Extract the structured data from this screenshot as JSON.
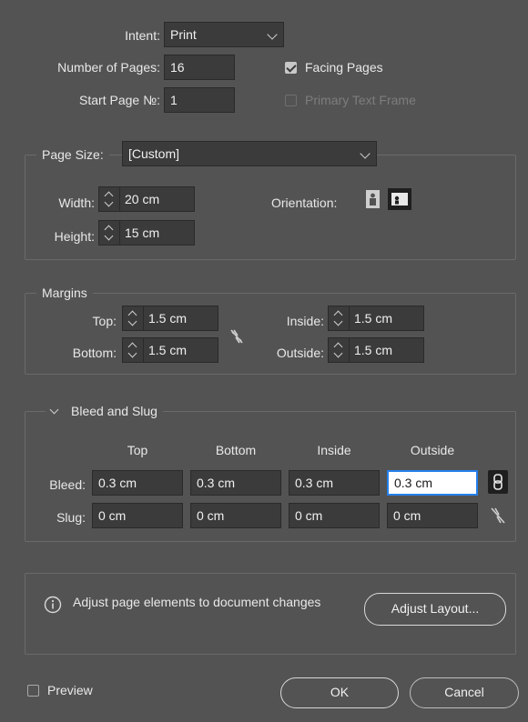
{
  "document": {
    "intent_label": "Intent:",
    "intent_value": "Print",
    "pages_label": "Number of Pages:",
    "pages_value": "16",
    "start_label": "Start Page №:",
    "start_value": "1",
    "facing_pages_label": "Facing Pages",
    "facing_pages_checked": true,
    "primary_text_frame_label": "Primary Text Frame",
    "primary_text_frame_checked": false
  },
  "page_size": {
    "label": "Page Size:",
    "value": "[Custom]",
    "width_label": "Width:",
    "width_value": "20 cm",
    "height_label": "Height:",
    "height_value": "15 cm",
    "orientation_label": "Orientation:",
    "orientation_icons": [
      "portrait-icon",
      "landscape-icon"
    ],
    "orientation_selected": "landscape"
  },
  "margins": {
    "title": "Margins",
    "top_label": "Top:",
    "top_value": "1.5 cm",
    "bottom_label": "Bottom:",
    "bottom_value": "1.5 cm",
    "inside_label": "Inside:",
    "inside_value": "1.5 cm",
    "outside_label": "Outside:",
    "outside_value": "1.5 cm",
    "link_icon": "unlink-icon"
  },
  "bleed_slug": {
    "title": "Bleed and Slug",
    "columns": [
      "Top",
      "Bottom",
      "Inside",
      "Outside"
    ],
    "bleed_label": "Bleed:",
    "bleed_values": [
      "0.3 cm",
      "0.3 cm",
      "0.3 cm",
      "0.3 cm"
    ],
    "slug_label": "Slug:",
    "slug_values": [
      "0 cm",
      "0 cm",
      "0 cm",
      "0 cm"
    ],
    "bleed_link_icon": "link-icon",
    "slug_link_icon": "unlink-icon"
  },
  "adjust": {
    "info_text": "Adjust page elements to document changes",
    "button_label": "Adjust Layout..."
  },
  "footer": {
    "preview_label": "Preview",
    "preview_checked": false,
    "ok_label": "OK",
    "cancel_label": "Cancel"
  },
  "colors": {
    "background": "#535353",
    "field": "#3b3b3b",
    "focus_ring": "#2680eb"
  }
}
